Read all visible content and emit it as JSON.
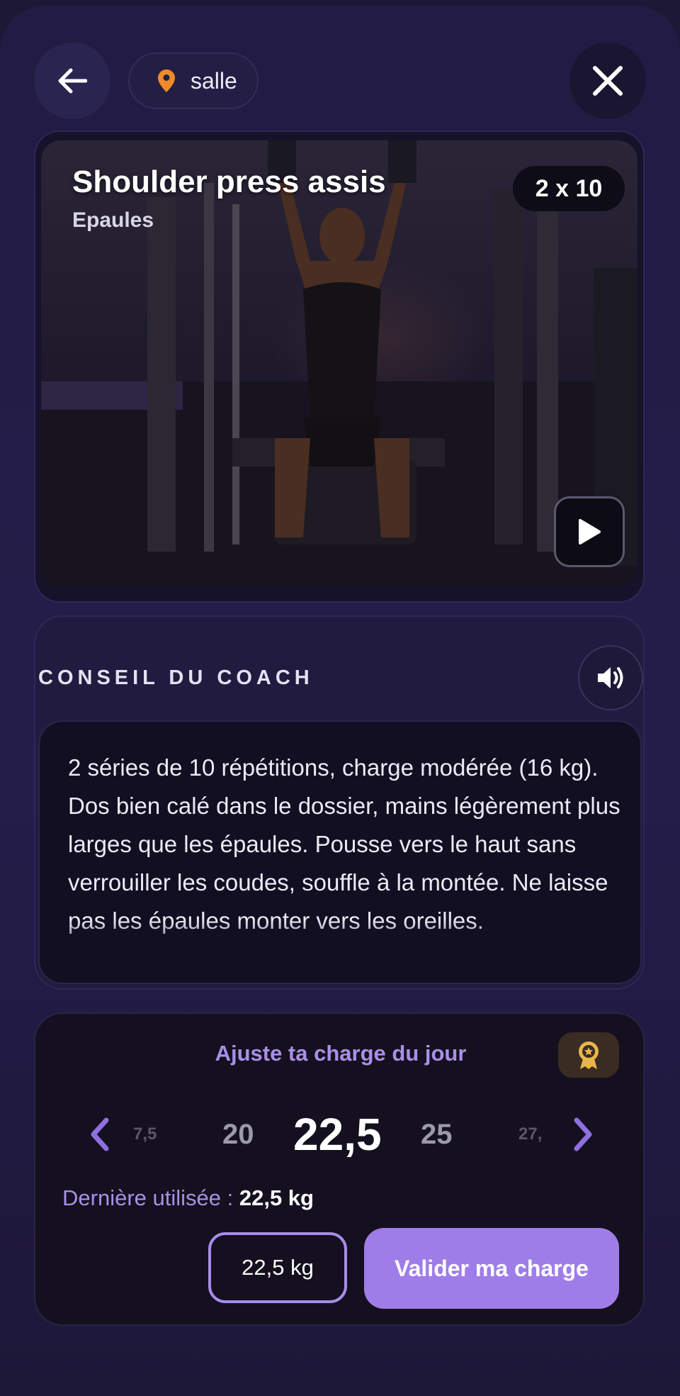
{
  "header": {
    "location_label": "salle",
    "icons": {
      "back": "arrow-left-icon",
      "location": "map-pin-icon",
      "close": "close-icon"
    },
    "colors": {
      "pin": "#f08a2a"
    }
  },
  "exercise": {
    "title": "Shoulder press assis",
    "muscle_group": "Epaules",
    "sets_reps": "2 x 10",
    "image": "photo of a man performing a seated shoulder press on a gym machine"
  },
  "coach": {
    "title": "CONSEIL DU COACH",
    "advice": "2 séries de 10 répétitions, charge modérée (16 kg). Dos bien calé dans le dossier, mains légèrement plus larges que les épaules. Pousse vers le haut sans verrouiller les coudes, souffle à la montée. Ne laisse pas les épaules monter vers les oreilles."
  },
  "charge": {
    "title": "Ajuste ta charge du jour",
    "picker": {
      "far_left": "7,5",
      "left": "20",
      "current": "22,5",
      "right": "25",
      "far_right": "27,"
    },
    "last_used_label": "Dernière utilisée :",
    "last_used_value": "22,5 kg",
    "selected_button": "22,5 kg",
    "validate_button": "Valider ma charge",
    "colors": {
      "accent": "#9f7de8",
      "award_bg": "#3a2c22",
      "award_icon": "#e9b64a"
    }
  }
}
